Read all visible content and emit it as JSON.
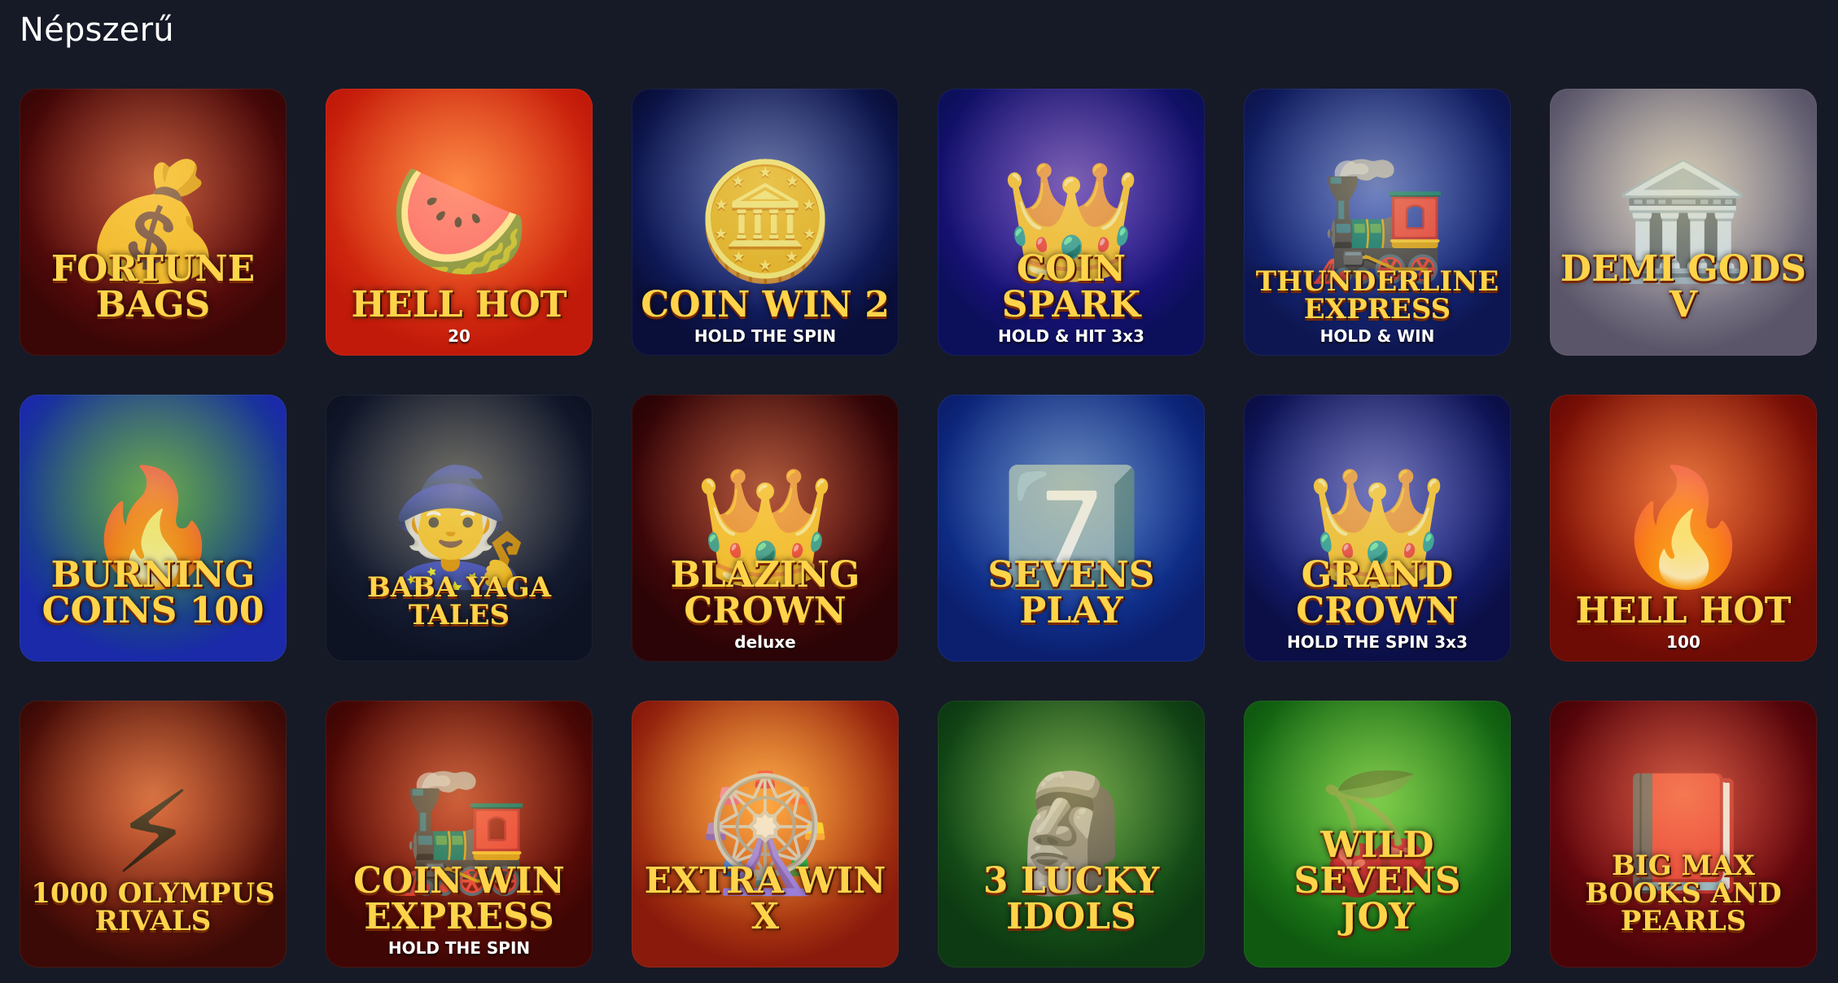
{
  "section": {
    "title": "Népszerű"
  },
  "games": [
    {
      "title": "FORTUNE BAGS",
      "subtitle": "",
      "icon": "💰",
      "bg": [
        "#a01616",
        "#3b0606"
      ]
    },
    {
      "title": "HELL HOT",
      "subtitle": "20",
      "icon": "🍉",
      "bg": [
        "#ff5a1f",
        "#c21a0a"
      ]
    },
    {
      "title": "COIN WIN 2",
      "subtitle": "HOLD THE SPIN",
      "icon": "🪙",
      "bg": [
        "#1f3fbf",
        "#0a0f3a"
      ]
    },
    {
      "title": "COIN SPARK",
      "subtitle": "HOLD & HIT 3x3",
      "icon": "👑",
      "bg": [
        "#3b1ad1",
        "#0c0f5a"
      ]
    },
    {
      "title": "THUNDERLINE EXPRESS",
      "subtitle": "HOLD & WIN",
      "icon": "🚂",
      "bg": [
        "#2a50d6",
        "#0d1650"
      ]
    },
    {
      "title": "DEMI GODS V",
      "subtitle": "",
      "icon": "🏛️",
      "bg": [
        "#c7c3cf",
        "#5a5568"
      ]
    },
    {
      "title": "BURNING COINS 100",
      "subtitle": "",
      "icon": "🔥",
      "bg": [
        "#1c8a2a",
        "#1a2aa8"
      ]
    },
    {
      "title": "BABA YAGA TALES",
      "subtitle": "",
      "icon": "🧙",
      "bg": [
        "#2b3658",
        "#0e1324"
      ]
    },
    {
      "title": "BLAZING CROWN",
      "subtitle": "deluxe",
      "icon": "👑",
      "bg": [
        "#8a0f12",
        "#2a0406"
      ]
    },
    {
      "title": "SEVENS PLAY",
      "subtitle": "",
      "icon": "7️⃣",
      "bg": [
        "#1d5fe0",
        "#0b1f6e"
      ]
    },
    {
      "title": "GRAND CROWN",
      "subtitle": "HOLD THE SPIN 3x3",
      "icon": "👑",
      "bg": [
        "#2d3fd6",
        "#0b0f46"
      ]
    },
    {
      "title": "HELL HOT",
      "subtitle": "100",
      "icon": "🔥",
      "bg": [
        "#e13a12",
        "#6d0b05"
      ]
    },
    {
      "title": "1000 OLYMPUS RIVALS",
      "subtitle": "",
      "icon": "⚡",
      "bg": [
        "#c8371c",
        "#3c0a06"
      ]
    },
    {
      "title": "COIN WIN EXPRESS",
      "subtitle": "HOLD THE SPIN",
      "icon": "🚂",
      "bg": [
        "#b51c10",
        "#3e0604"
      ]
    },
    {
      "title": "EXTRA WIN X",
      "subtitle": "",
      "icon": "🎡",
      "bg": [
        "#ff8a1f",
        "#8a1a0c"
      ]
    },
    {
      "title": "3 LUCKY IDOLS",
      "subtitle": "",
      "icon": "🗿",
      "bg": [
        "#2f8a2a",
        "#0d3a12"
      ]
    },
    {
      "title": "WILD SEVENS JOY",
      "subtitle": "",
      "icon": "🍒",
      "bg": [
        "#3fbf2a",
        "#0f5a10"
      ]
    },
    {
      "title": "BIG MAX BOOKS AND PEARLS",
      "subtitle": "",
      "icon": "📕",
      "bg": [
        "#c0111e",
        "#4a0408"
      ]
    }
  ]
}
